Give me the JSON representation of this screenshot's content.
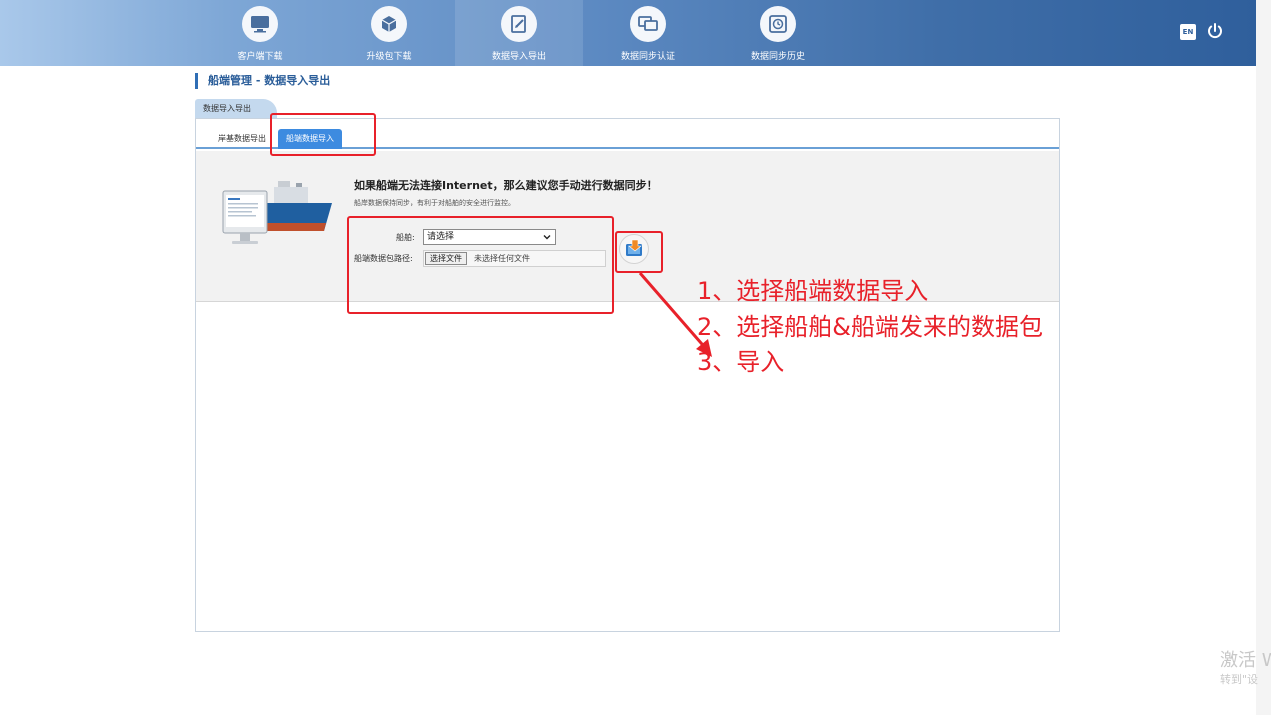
{
  "nav": {
    "items": [
      {
        "label": "客户端下载",
        "icon": "monitor-icon"
      },
      {
        "label": "升级包下载",
        "icon": "package-icon"
      },
      {
        "label": "数据导入导出",
        "icon": "edit-document-icon",
        "active": true
      },
      {
        "label": "数据同步认证",
        "icon": "dual-monitor-icon"
      },
      {
        "label": "数据同步历史",
        "icon": "history-icon"
      }
    ],
    "lang": "EN",
    "power_icon": "power-icon"
  },
  "breadcrumb": {
    "text": "船端管理 - 数据导入导出"
  },
  "panel": {
    "tab_title": "数据导入导出",
    "subtabs": {
      "export": "岸基数据导出",
      "import": "船端数据导入"
    },
    "headline": "如果船端无法连接Internet，那么建议您手动进行数据同步！",
    "subline": "船岸数据保持同步，有利于对船舶的安全进行监控。",
    "ship_label": "船舶:",
    "ship_select": "请选择",
    "path_label": "船端数据包路径:",
    "file_button": "选择文件",
    "file_status": "未选择任何文件",
    "import_icon": "import-icon"
  },
  "annotations": {
    "step1": "1、选择船端数据导入",
    "step2": "2、选择船舶&船端发来的数据包",
    "step3": "3、导入"
  },
  "watermark": {
    "line1": "激活 W",
    "line2": "转到\"设"
  },
  "colors": {
    "accent": "#2f6eb5",
    "annotation": "#e8212a",
    "tab_active": "#3d8be0"
  }
}
